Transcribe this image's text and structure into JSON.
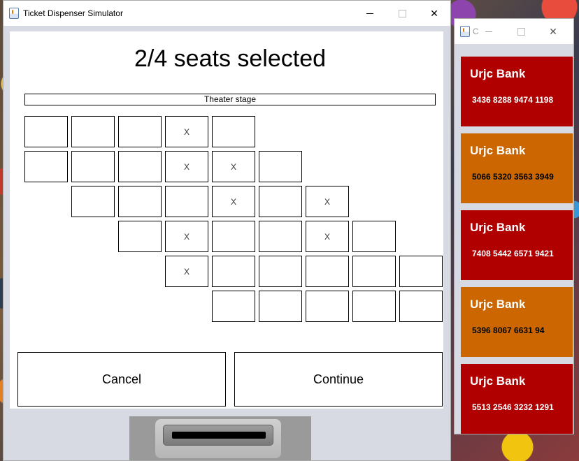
{
  "main_window": {
    "title": "Ticket Dispenser Simulator",
    "controls": {
      "minimize": "—",
      "maximize": "☐",
      "close": "✕"
    },
    "heading": "2/4 seats selected",
    "stage_label": "Theater stage",
    "seat_rows": [
      [
        "",
        "",
        "",
        "X",
        ""
      ],
      [
        "",
        "",
        "",
        "X",
        "X",
        ""
      ],
      [
        "",
        "",
        "",
        "X",
        "",
        "X"
      ],
      [
        "",
        "X",
        "",
        "",
        "X",
        ""
      ],
      [
        "X",
        "",
        "",
        "",
        "",
        ""
      ],
      [
        "",
        "",
        "",
        "",
        ""
      ]
    ],
    "buttons": {
      "cancel": "Cancel",
      "continue": "Continue"
    }
  },
  "card_window": {
    "title": "C",
    "cards": [
      {
        "bank": "Urjc Bank",
        "number": "3436 8288 9474 1198",
        "color": "#b00000",
        "text_color": "#ffffff"
      },
      {
        "bank": "Urjc Bank",
        "number": "5066 5320 3563 3949",
        "color": "#cc6600",
        "text_color": "#000000"
      },
      {
        "bank": "Urjc Bank",
        "number": "7408 5442 6571 9421",
        "color": "#b00000",
        "text_color": "#ffffff"
      },
      {
        "bank": "Urjc Bank",
        "number": "5396 8067 6631 94",
        "color": "#cc6600",
        "text_color": "#000000"
      },
      {
        "bank": "Urjc Bank",
        "number": "5513 2546 3232 1291",
        "color": "#b00000",
        "text_color": "#ffffff"
      }
    ]
  },
  "colors": {
    "frame_bg": "#d7dae3",
    "slot_bg": "#9a9a9a"
  }
}
